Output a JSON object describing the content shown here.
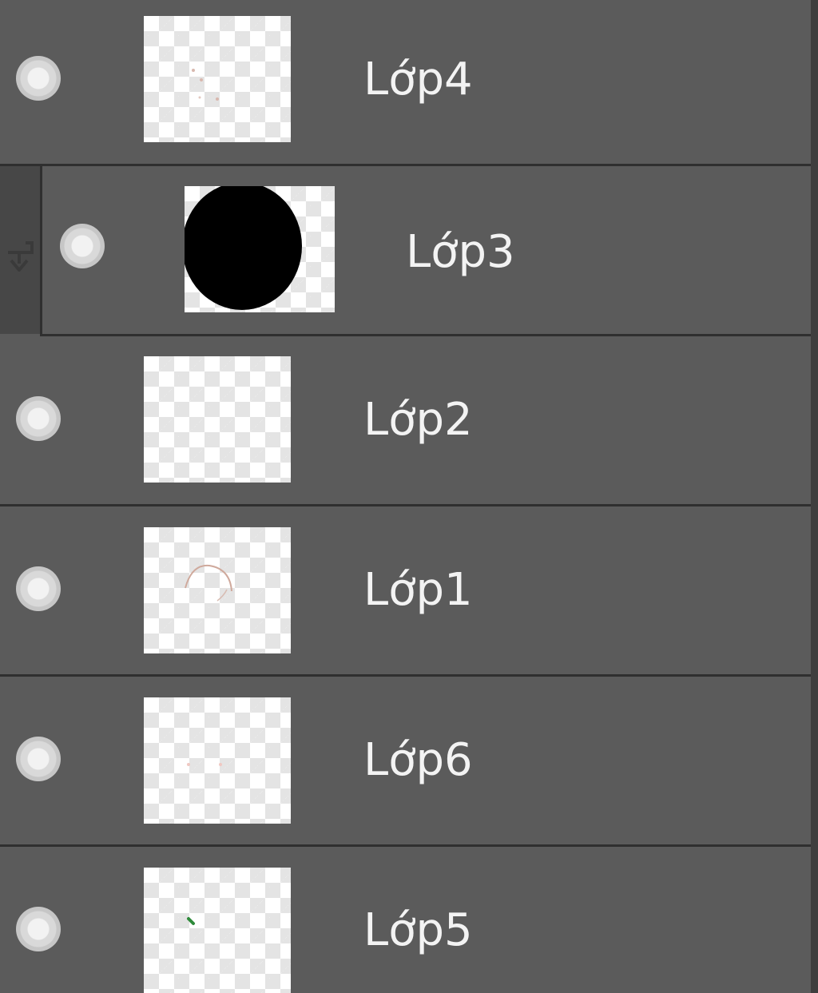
{
  "layers_panel": {
    "layers": [
      {
        "name": "Lớp4",
        "visible": true,
        "clipped": false,
        "thumbnail": "faint-marks"
      },
      {
        "name": "Lớp3",
        "visible": true,
        "clipped": true,
        "thumbnail": "black-circle"
      },
      {
        "name": "Lớp2",
        "visible": true,
        "clipped": false,
        "thumbnail": "empty"
      },
      {
        "name": "Lớp1",
        "visible": true,
        "clipped": false,
        "thumbnail": "faint-arc"
      },
      {
        "name": "Lớp6",
        "visible": true,
        "clipped": false,
        "thumbnail": "faint-marks"
      },
      {
        "name": "Lớp5",
        "visible": true,
        "clipped": false,
        "thumbnail": "green-dot"
      }
    ],
    "icons": {
      "visibility": "eye-icon",
      "clipping": "clipping-mask-arrow-icon"
    },
    "colors": {
      "panel_bg": "#5b5b5b",
      "row_divider": "#2f2f2f",
      "label_text": "#f3f3f3",
      "clip_gutter": "#474747"
    }
  }
}
